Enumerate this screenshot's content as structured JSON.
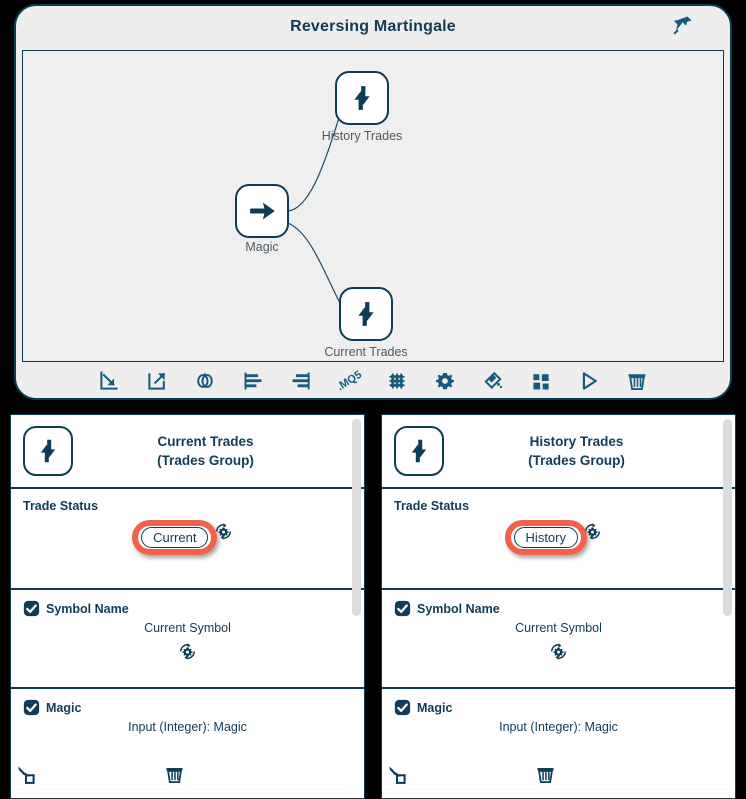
{
  "diagram": {
    "title": "Reversing Martingale",
    "pin_icon": "pushpin-icon",
    "nodes": [
      {
        "id": "history",
        "label": "History Trades",
        "icon": "trades-updown-icon"
      },
      {
        "id": "magic",
        "label": "Magic",
        "icon": "arrow-right-icon"
      },
      {
        "id": "current",
        "label": "Current Trades",
        "icon": "trades-updown-icon"
      }
    ],
    "toolbar": [
      {
        "name": "import-icon",
        "label": "Import"
      },
      {
        "name": "export-icon",
        "label": "Export"
      },
      {
        "name": "duplicate-icon",
        "label": "Duplicate"
      },
      {
        "name": "align-left-icon",
        "label": "Align Left"
      },
      {
        "name": "align-right-icon",
        "label": "Align Right"
      },
      {
        "name": "mq5-icon",
        "label": ".MQ5"
      },
      {
        "name": "grid-icon",
        "label": "Grid"
      },
      {
        "name": "settings-gear-icon",
        "label": "Settings"
      },
      {
        "name": "eraser-icon",
        "label": "Eraser"
      },
      {
        "name": "blocks-icon",
        "label": "Blocks"
      },
      {
        "name": "play-icon",
        "label": "Run"
      },
      {
        "name": "trash-icon",
        "label": "Delete"
      }
    ]
  },
  "panels": [
    {
      "id": "current-trades",
      "icon": "trades-updown-icon",
      "title": "Current Trades",
      "subtitle": "(Trades Group)",
      "rows": [
        {
          "label": "Trade Status",
          "checkbox": false,
          "value": "Current",
          "value_highlighted": true,
          "action_icon": "refresh-gear-icon"
        },
        {
          "label": "Symbol Name",
          "checkbox": true,
          "value": "Current Symbol",
          "value_highlighted": false,
          "action_icon": "refresh-gear-icon"
        },
        {
          "label": "Magic",
          "checkbox": true,
          "value": "Input (Integer): Magic",
          "value_highlighted": false,
          "action_icon": "trash-icon",
          "connector_icon": "connector-node-icon"
        }
      ]
    },
    {
      "id": "history-trades",
      "icon": "trades-updown-icon",
      "title": "History Trades",
      "subtitle": "(Trades Group)",
      "rows": [
        {
          "label": "Trade Status",
          "checkbox": false,
          "value": "History",
          "value_highlighted": true,
          "action_icon": "refresh-gear-icon"
        },
        {
          "label": "Symbol Name",
          "checkbox": true,
          "value": "Current Symbol",
          "value_highlighted": false,
          "action_icon": "refresh-gear-icon"
        },
        {
          "label": "Magic",
          "checkbox": true,
          "value": "Input (Integer): Magic",
          "value_highlighted": false,
          "action_icon": "trash-icon",
          "connector_icon": "connector-node-icon"
        }
      ]
    }
  ],
  "colors": {
    "ink": "#123b56",
    "border": "#0d3c55",
    "highlight": "#f4614a",
    "panel_bg": "#ffffff",
    "card_bg": "#eeeeee"
  }
}
